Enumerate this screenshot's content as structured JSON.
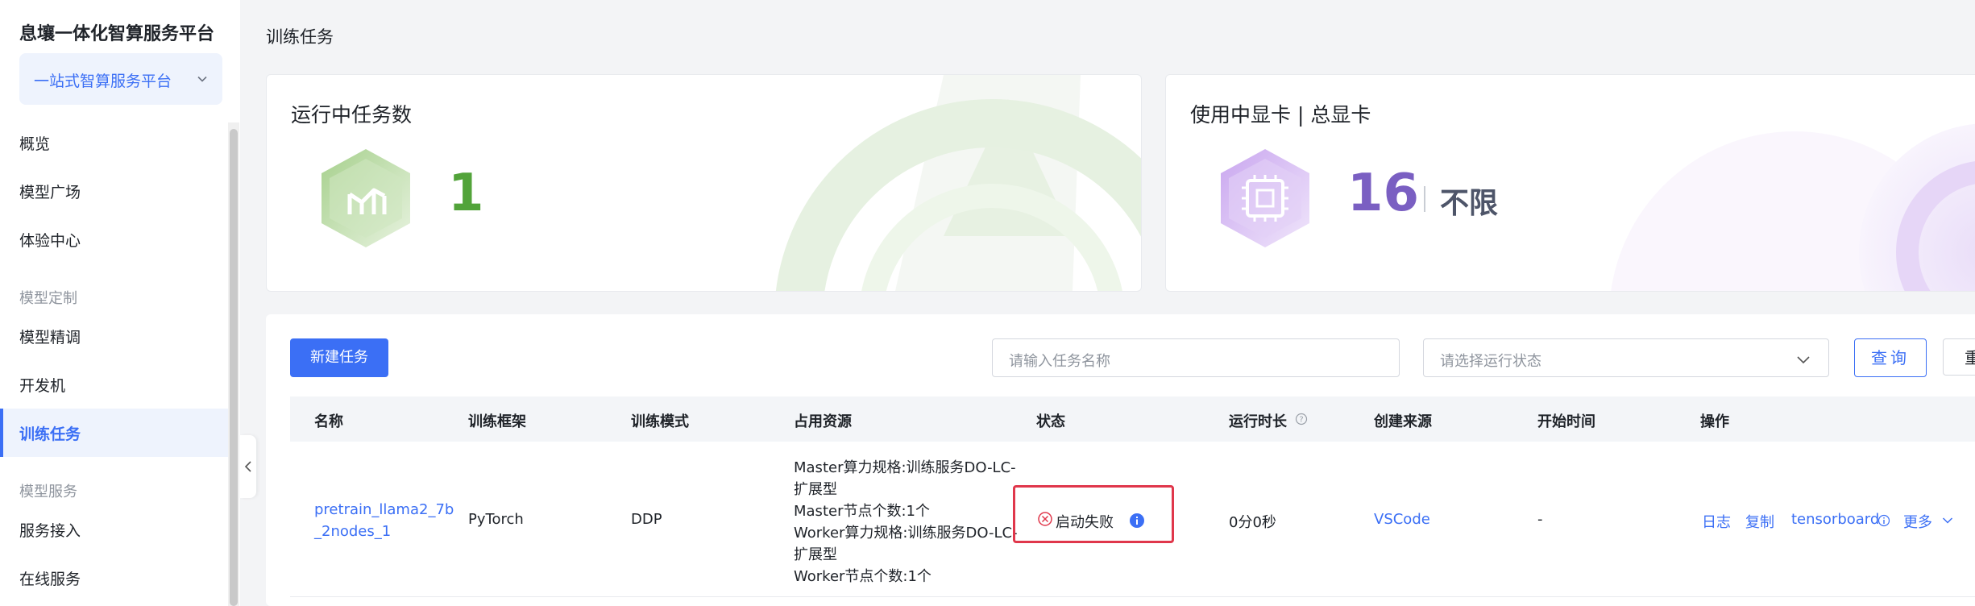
{
  "sidebar": {
    "brand": "息壤一体化智算服务平台",
    "platform_select": "一站式智算服务平台",
    "items": {
      "overview": "概览",
      "model_square": "模型广场",
      "experience": "体验中心",
      "group_custom": "模型定制",
      "finetune": "模型精调",
      "devbox": "开发机",
      "training": "训练任务",
      "group_service": "模型服务",
      "service_access": "服务接入",
      "online_service": "在线服务"
    }
  },
  "page_title": "训练任务",
  "cards": {
    "running": {
      "title": "运行中任务数",
      "value": "1"
    },
    "gpu": {
      "title": "使用中显卡 | 总显卡",
      "value": "16",
      "total": "不限"
    }
  },
  "toolbar": {
    "new_task": "新建任务",
    "name_placeholder": "请输入任务名称",
    "status_placeholder": "请选择运行状态",
    "query": "查询",
    "reset": "重"
  },
  "table": {
    "headers": {
      "name": "名称",
      "framework": "训练框架",
      "mode": "训练模式",
      "resources": "占用资源",
      "status": "状态",
      "duration": "运行时长",
      "source": "创建来源",
      "start_time": "开始时间",
      "actions": "操作"
    },
    "row": {
      "name_line1": "pretrain_llama2_7b",
      "name_line2": "_2nodes_1",
      "framework": "PyTorch",
      "mode": "DDP",
      "resources": [
        "Master算力规格:训练服务DO-LC-",
        "扩展型",
        "Master节点个数:1个",
        "Worker算力规格:训练服务DO-LC-",
        "扩展型",
        "Worker节点个数:1个"
      ],
      "status": "启动失败",
      "duration": "0分0秒",
      "source": "VSCode",
      "start_time": "-",
      "actions": {
        "log": "日志",
        "copy": "复制",
        "tensorboard": "tensorboard",
        "more": "更多"
      }
    }
  },
  "colors": {
    "accent": "#3b6ff5",
    "success": "#52a33a",
    "purple": "#7a5fc2",
    "error": "#e0374b"
  }
}
